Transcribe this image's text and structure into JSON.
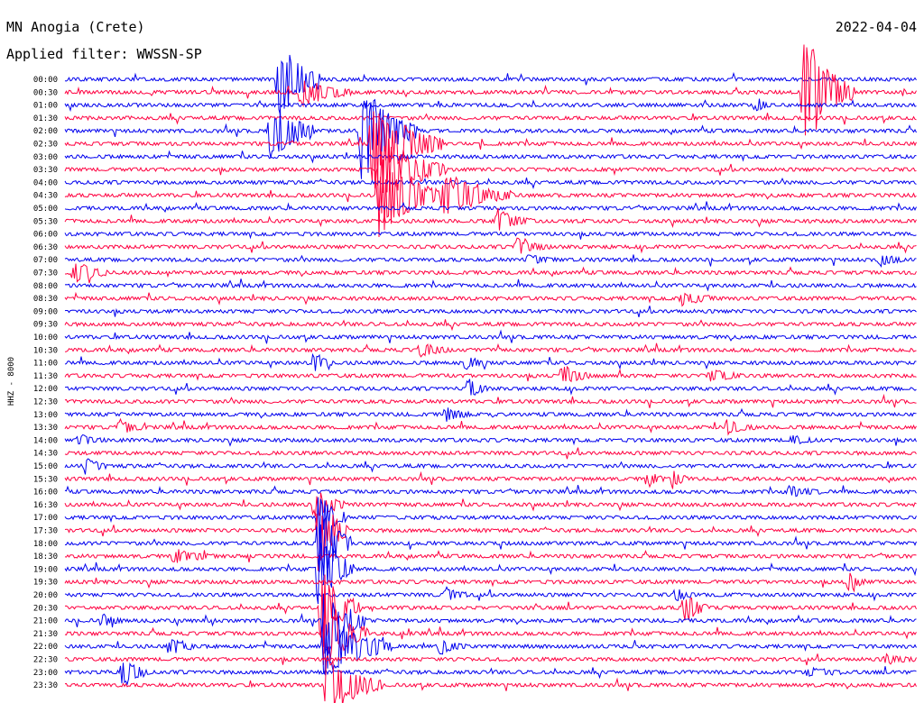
{
  "header": {
    "station": "MN Anogia (Crete)",
    "filter": "Applied filter: WWSSN-SP",
    "date": "2022-04-04",
    "channel": "HHZ  - 8000"
  },
  "chart_data": {
    "type": "helicorder",
    "title": "MN Anogia (Crete)",
    "subtitle": "Applied filter: WWSSN-SP",
    "date": "2022-04-04",
    "ylabel": "HHZ  - 8000",
    "trace_colors": [
      "#0000ee",
      "#ff0040"
    ],
    "row_minutes": 30,
    "row_labels": [
      "00:00",
      "00:30",
      "01:00",
      "01:30",
      "02:00",
      "02:30",
      "03:00",
      "03:30",
      "04:00",
      "04:30",
      "05:00",
      "05:30",
      "06:00",
      "06:30",
      "07:00",
      "07:30",
      "08:00",
      "08:30",
      "09:00",
      "09:30",
      "10:00",
      "10:30",
      "11:00",
      "11:30",
      "12:00",
      "12:30",
      "13:00",
      "13:30",
      "14:00",
      "14:30",
      "15:00",
      "15:30",
      "16:00",
      "16:30",
      "17:00",
      "17:30",
      "18:00",
      "18:30",
      "19:00",
      "19:30",
      "20:00",
      "20:30",
      "21:00",
      "21:30",
      "22:00",
      "22:30",
      "23:00",
      "23:30"
    ],
    "events": [
      {
        "row": 0,
        "minute": 7.5,
        "amplitude": 3.2,
        "duration_min": 1.5
      },
      {
        "row": 1,
        "minute": 8.3,
        "amplitude": 1.2,
        "duration_min": 1.8
      },
      {
        "row": 1,
        "minute": 26.0,
        "amplitude": 4.6,
        "duration_min": 1.8
      },
      {
        "row": 2,
        "minute": 24.4,
        "amplitude": 0.6,
        "duration_min": 0.5
      },
      {
        "row": 4,
        "minute": 7.2,
        "amplitude": 2.6,
        "duration_min": 1.6
      },
      {
        "row": 4,
        "minute": 10.4,
        "amplitude": 4.0,
        "duration_min": 2.0
      },
      {
        "row": 5,
        "minute": 10.8,
        "amplitude": 3.5,
        "duration_min": 2.5
      },
      {
        "row": 7,
        "minute": 11.0,
        "amplitude": 3.0,
        "duration_min": 2.4
      },
      {
        "row": 9,
        "minute": 11.0,
        "amplitude": 3.5,
        "duration_min": 2.2
      },
      {
        "row": 9,
        "minute": 13.3,
        "amplitude": 1.8,
        "duration_min": 2.5
      },
      {
        "row": 11,
        "minute": 15.2,
        "amplitude": 0.9,
        "duration_min": 1.3
      },
      {
        "row": 13,
        "minute": 15.9,
        "amplitude": 0.6,
        "duration_min": 1.2
      },
      {
        "row": 14,
        "minute": 16.3,
        "amplitude": 0.4,
        "duration_min": 1.0
      },
      {
        "row": 14,
        "minute": 28.7,
        "amplitude": 0.7,
        "duration_min": 0.8
      },
      {
        "row": 15,
        "minute": 0.3,
        "amplitude": 1.0,
        "duration_min": 1.2
      },
      {
        "row": 17,
        "minute": 21.7,
        "amplitude": 0.6,
        "duration_min": 1.2
      },
      {
        "row": 21,
        "minute": 12.5,
        "amplitude": 0.5,
        "duration_min": 1.3
      },
      {
        "row": 22,
        "minute": 8.8,
        "amplitude": 1.0,
        "duration_min": 0.6
      },
      {
        "row": 22,
        "minute": 14.1,
        "amplitude": 0.6,
        "duration_min": 0.8
      },
      {
        "row": 23,
        "minute": 17.5,
        "amplitude": 0.8,
        "duration_min": 1.0
      },
      {
        "row": 23,
        "minute": 22.7,
        "amplitude": 0.5,
        "duration_min": 1.2
      },
      {
        "row": 24,
        "minute": 14.2,
        "amplitude": 0.9,
        "duration_min": 0.7
      },
      {
        "row": 26,
        "minute": 13.4,
        "amplitude": 0.6,
        "duration_min": 0.9
      },
      {
        "row": 27,
        "minute": 1.9,
        "amplitude": 0.6,
        "duration_min": 0.8
      },
      {
        "row": 27,
        "minute": 23.3,
        "amplitude": 0.5,
        "duration_min": 1.1
      },
      {
        "row": 28,
        "minute": 0.5,
        "amplitude": 0.4,
        "duration_min": 0.9
      },
      {
        "row": 28,
        "minute": 25.6,
        "amplitude": 0.4,
        "duration_min": 0.8
      },
      {
        "row": 30,
        "minute": 0.7,
        "amplitude": 0.6,
        "duration_min": 0.8
      },
      {
        "row": 31,
        "minute": 20.5,
        "amplitude": 0.6,
        "duration_min": 0.6
      },
      {
        "row": 31,
        "minute": 21.4,
        "amplitude": 0.7,
        "duration_min": 0.6
      },
      {
        "row": 32,
        "minute": 25.5,
        "amplitude": 0.4,
        "duration_min": 1.2
      },
      {
        "row": 33,
        "minute": 8.8,
        "amplitude": 1.2,
        "duration_min": 1.1
      },
      {
        "row": 34,
        "minute": 8.9,
        "amplitude": 2.3,
        "duration_min": 1.0
      },
      {
        "row": 35,
        "minute": 8.9,
        "amplitude": 3.0,
        "duration_min": 1.1
      },
      {
        "row": 36,
        "minute": 8.9,
        "amplitude": 3.4,
        "duration_min": 1.2
      },
      {
        "row": 37,
        "minute": 3.8,
        "amplitude": 0.5,
        "duration_min": 1.6
      },
      {
        "row": 38,
        "minute": 8.9,
        "amplitude": 3.6,
        "duration_min": 1.3
      },
      {
        "row": 39,
        "minute": 27.6,
        "amplitude": 0.7,
        "duration_min": 0.6
      },
      {
        "row": 40,
        "minute": 13.4,
        "amplitude": 0.6,
        "duration_min": 0.8
      },
      {
        "row": 40,
        "minute": 21.5,
        "amplitude": 0.5,
        "duration_min": 0.7
      },
      {
        "row": 41,
        "minute": 21.8,
        "amplitude": 1.4,
        "duration_min": 0.8
      },
      {
        "row": 41,
        "minute": 9.0,
        "amplitude": 3.3,
        "duration_min": 1.4
      },
      {
        "row": 42,
        "minute": 1.3,
        "amplitude": 0.5,
        "duration_min": 0.8
      },
      {
        "row": 42,
        "minute": 9.1,
        "amplitude": 3.1,
        "duration_min": 1.5
      },
      {
        "row": 43,
        "minute": 9.1,
        "amplitude": 3.0,
        "duration_min": 1.6
      },
      {
        "row": 44,
        "minute": 3.7,
        "amplitude": 0.8,
        "duration_min": 0.9
      },
      {
        "row": 44,
        "minute": 9.1,
        "amplitude": 2.8,
        "duration_min": 2.4
      },
      {
        "row": 44,
        "minute": 13.2,
        "amplitude": 0.6,
        "duration_min": 1.0
      },
      {
        "row": 45,
        "minute": 28.9,
        "amplitude": 0.4,
        "duration_min": 1.0
      },
      {
        "row": 46,
        "minute": 2.0,
        "amplitude": 1.2,
        "duration_min": 1.0
      },
      {
        "row": 46,
        "minute": 26.2,
        "amplitude": 0.4,
        "duration_min": 1.2
      },
      {
        "row": 47,
        "minute": 9.2,
        "amplitude": 2.5,
        "duration_min": 2.0
      }
    ]
  }
}
